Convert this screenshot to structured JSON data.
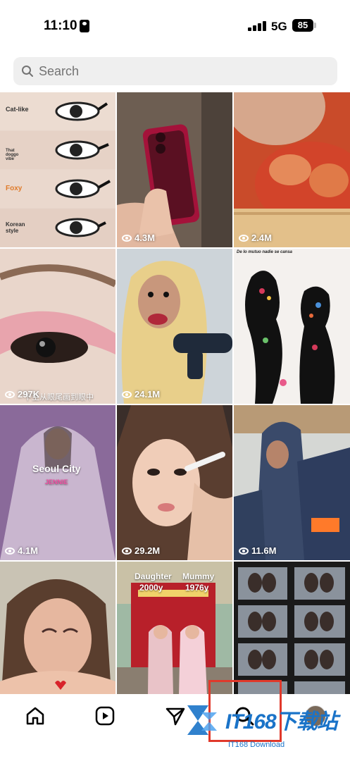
{
  "status_bar": {
    "time": "11:10",
    "network": "5G",
    "battery": "85"
  },
  "search": {
    "placeholder": "Search"
  },
  "grid": [
    {
      "id": "makeup-eyes",
      "labels": [
        "Cat-like",
        "That doggo vibe",
        "Foxy",
        "Korean style"
      ],
      "views": ""
    },
    {
      "id": "red-phone",
      "views": "4.3M"
    },
    {
      "id": "food-eating",
      "views": "2.4M"
    },
    {
      "id": "pink-eyeshadow",
      "views": "297K",
      "caption": "下至从眼尾画到眼中"
    },
    {
      "id": "monkey-hairdryer",
      "views": "24.1M"
    },
    {
      "id": "silhouette-art",
      "views": "",
      "caption": "De lo mutuo nadie se cansa"
    },
    {
      "id": "seoul-city",
      "title": "Seoul City",
      "subtitle": "JENNIE",
      "views": "4.1M"
    },
    {
      "id": "makeup-artist",
      "views": "29.2M"
    },
    {
      "id": "hijab-friends",
      "views": "11.6M"
    },
    {
      "id": "crying-girl",
      "views": ""
    },
    {
      "id": "daughter-mummy",
      "left_label": "Daughter",
      "left_year": "2000y",
      "right_label": "Mummy",
      "right_year": "1976y",
      "views": ""
    },
    {
      "id": "photo-strips",
      "views": ""
    }
  ],
  "bottom_nav": {
    "items": [
      {
        "name": "home",
        "icon": "home-icon"
      },
      {
        "name": "reels",
        "icon": "reels-icon"
      },
      {
        "name": "direct",
        "icon": "send-icon"
      },
      {
        "name": "search",
        "icon": "search-icon"
      },
      {
        "name": "profile",
        "icon": "avatar"
      }
    ]
  },
  "watermark": {
    "text": "IT168下载站",
    "sub": "IT168 Download"
  },
  "colors": {
    "accent": "#1a73c8",
    "watermark_box": "#e0392b"
  }
}
